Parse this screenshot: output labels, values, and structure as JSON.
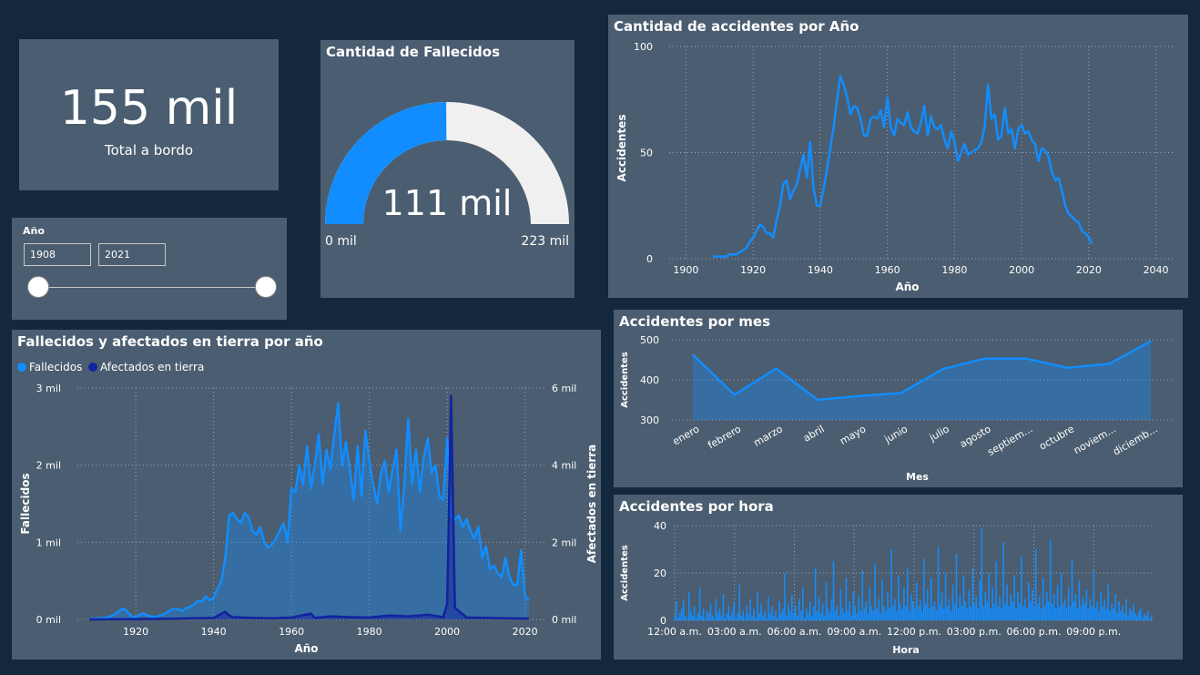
{
  "kpi": {
    "value": "155 mil",
    "label": "Total a bordo"
  },
  "slicer": {
    "title": "Año",
    "from": "1908",
    "to": "2021"
  },
  "gauge": {
    "title": "Cantidad de Fallecidos",
    "value_label": "111 mil",
    "min_label": "0 mil",
    "max_label": "223 mil",
    "value": 111,
    "min": 0,
    "max": 223
  },
  "colors": {
    "background": "#14283d",
    "card": "#4b5d70",
    "accent_blue": "#118dff",
    "dark_navy": "#12239e",
    "gauge_empty": "#f1f0f0"
  },
  "chart_data": [
    {
      "id": "accidentes_por_anio",
      "type": "line",
      "title": "Cantidad de accidentes por Año",
      "xlabel": "Año",
      "ylabel": "Accidentes",
      "xlim": [
        1895,
        2045
      ],
      "ylim": [
        0,
        100
      ],
      "xticks": [
        1900,
        1920,
        1940,
        1960,
        1980,
        2000,
        2020,
        2040
      ],
      "yticks": [
        0,
        50,
        100
      ],
      "grid": true,
      "x": [
        1908,
        1910,
        1912,
        1913,
        1914,
        1915,
        1916,
        1917,
        1918,
        1919,
        1920,
        1921,
        1922,
        1923,
        1924,
        1925,
        1926,
        1927,
        1928,
        1929,
        1930,
        1931,
        1932,
        1933,
        1934,
        1935,
        1936,
        1937,
        1938,
        1939,
        1940,
        1941,
        1942,
        1943,
        1944,
        1945,
        1946,
        1947,
        1948,
        1949,
        1950,
        1951,
        1952,
        1953,
        1954,
        1955,
        1956,
        1957,
        1958,
        1959,
        1960,
        1961,
        1962,
        1963,
        1964,
        1965,
        1966,
        1967,
        1968,
        1969,
        1970,
        1971,
        1972,
        1973,
        1974,
        1975,
        1976,
        1977,
        1978,
        1979,
        1980,
        1981,
        1982,
        1983,
        1984,
        1985,
        1986,
        1987,
        1988,
        1989,
        1990,
        1991,
        1992,
        1993,
        1994,
        1995,
        1996,
        1997,
        1998,
        1999,
        2000,
        2001,
        2002,
        2003,
        2004,
        2005,
        2006,
        2007,
        2008,
        2009,
        2010,
        2011,
        2012,
        2013,
        2014,
        2015,
        2016,
        2017,
        2018,
        2019,
        2020,
        2021
      ],
      "y": [
        1,
        1,
        1,
        2,
        2,
        2,
        3,
        4,
        5,
        8,
        10,
        13,
        16,
        15,
        12,
        12,
        10,
        18,
        25,
        35,
        37,
        28,
        32,
        35,
        42,
        49,
        38,
        55,
        33,
        25,
        25,
        33,
        42,
        52,
        62,
        75,
        86,
        82,
        76,
        68,
        72,
        71,
        66,
        58,
        58,
        66,
        67,
        66,
        70,
        62,
        76,
        62,
        58,
        66,
        64,
        63,
        69,
        62,
        60,
        59,
        64,
        72,
        58,
        67,
        62,
        61,
        63,
        56,
        52,
        60,
        55,
        46,
        50,
        54,
        49,
        50,
        51,
        52,
        55,
        62,
        82,
        66,
        68,
        56,
        58,
        71,
        59,
        61,
        52,
        61,
        63,
        59,
        60,
        56,
        54,
        46,
        52,
        51,
        48,
        41,
        37,
        38,
        32,
        25,
        21,
        20,
        18,
        17,
        13,
        12,
        10,
        7
      ]
    },
    {
      "id": "fallecidos_afectados",
      "type": "area",
      "title": "Fallecidos y afectados en tierra por año",
      "xlabel": "Año",
      "ylabel": "Fallecidos",
      "ylabel_right": "Afectados en tierra",
      "xlim": [
        1905,
        2025
      ],
      "ylim": [
        0,
        3000
      ],
      "ylim_right": [
        0,
        6000
      ],
      "xticks": [
        1920,
        1940,
        1960,
        1980,
        2000,
        2020
      ],
      "yticks": [
        0,
        1000,
        2000,
        3000
      ],
      "ytick_labels": [
        "0 mil",
        "1 mil",
        "2 mil",
        "3 mil"
      ],
      "yticks_right": [
        0,
        2000,
        4000,
        6000
      ],
      "ytick_labels_right": [
        "0 mil",
        "2 mil",
        "4 mil",
        "6 mil"
      ],
      "legend": "top-left",
      "grid": true,
      "series": [
        {
          "name": "Fallecidos",
          "axis": "left",
          "x": [
            1908,
            1912,
            1913,
            1914,
            1915,
            1916,
            1917,
            1918,
            1919,
            1920,
            1921,
            1922,
            1923,
            1924,
            1925,
            1926,
            1927,
            1928,
            1929,
            1930,
            1931,
            1932,
            1933,
            1934,
            1935,
            1936,
            1937,
            1938,
            1939,
            1940,
            1941,
            1942,
            1943,
            1944,
            1945,
            1946,
            1947,
            1948,
            1949,
            1950,
            1951,
            1952,
            1953,
            1954,
            1955,
            1956,
            1957,
            1958,
            1959,
            1960,
            1961,
            1962,
            1963,
            1964,
            1965,
            1966,
            1967,
            1968,
            1969,
            1970,
            1971,
            1972,
            1973,
            1974,
            1975,
            1976,
            1977,
            1978,
            1979,
            1980,
            1981,
            1982,
            1983,
            1984,
            1985,
            1986,
            1987,
            1988,
            1989,
            1990,
            1991,
            1992,
            1993,
            1994,
            1995,
            1996,
            1997,
            1998,
            1999,
            2000,
            2001,
            2002,
            2003,
            2004,
            2005,
            2006,
            2007,
            2008,
            2009,
            2010,
            2011,
            2012,
            2013,
            2014,
            2015,
            2016,
            2017,
            2018,
            2019,
            2020,
            2021
          ],
          "y": [
            5,
            20,
            30,
            50,
            80,
            120,
            140,
            90,
            40,
            30,
            60,
            80,
            50,
            40,
            30,
            50,
            60,
            90,
            120,
            140,
            130,
            110,
            150,
            160,
            200,
            240,
            230,
            300,
            250,
            280,
            400,
            500,
            800,
            1350,
            1380,
            1300,
            1250,
            1380,
            1320,
            1150,
            1100,
            1200,
            1000,
            930,
            970,
            1050,
            1150,
            1250,
            1000,
            1700,
            1650,
            2000,
            1750,
            2250,
            1700,
            2000,
            2400,
            1750,
            2200,
            1950,
            2400,
            2800,
            2000,
            2300,
            1950,
            1550,
            2250,
            1600,
            2450,
            2050,
            1750,
            1500,
            1900,
            2050,
            1650,
            1950,
            2200,
            1150,
            1750,
            2600,
            1750,
            2200,
            1650,
            2100,
            2350,
            1900,
            2000,
            1600,
            1550,
            2350,
            1350,
            1300,
            1350,
            1200,
            1300,
            1150,
            1050,
            1200,
            800,
            950,
            650,
            700,
            600,
            550,
            800,
            550,
            450,
            450,
            900,
            300,
            250
          ]
        },
        {
          "name": "Afectados en tierra",
          "axis": "right",
          "x": [
            1908,
            1920,
            1930,
            1940,
            1943,
            1944,
            1945,
            1950,
            1955,
            1960,
            1965,
            1966,
            1970,
            1975,
            1980,
            1985,
            1990,
            1995,
            1999,
            2000,
            2001,
            2002,
            2005,
            2010,
            2015,
            2021
          ],
          "y": [
            0,
            10,
            20,
            40,
            200,
            100,
            60,
            40,
            30,
            50,
            150,
            40,
            80,
            60,
            50,
            100,
            80,
            120,
            60,
            400,
            5800,
            300,
            50,
            40,
            30,
            20
          ]
        }
      ]
    },
    {
      "id": "accidentes_por_mes",
      "type": "area",
      "title": "Accidentes por mes",
      "xlabel": "Mes",
      "ylabel": "Accidentes",
      "ylim": [
        300,
        500
      ],
      "yticks": [
        300,
        400,
        500
      ],
      "grid": true,
      "categories": [
        "enero",
        "febrero",
        "marzo",
        "abril",
        "mayo",
        "junio",
        "julio",
        "agosto",
        "septiem...",
        "octubre",
        "noviem...",
        "diciemb..."
      ],
      "values": [
        463,
        363,
        428,
        350,
        360,
        367,
        427,
        453,
        453,
        430,
        440,
        497
      ]
    },
    {
      "id": "accidentes_por_hora",
      "type": "bar",
      "title": "Accidentes por hora",
      "xlabel": "Hora",
      "ylabel": "Accidentes",
      "ylim": [
        0,
        40
      ],
      "yticks": [
        0,
        20,
        40
      ],
      "xtick_labels": [
        "12:00 a.m.",
        "03:00 a.m.",
        "06:00 a.m.",
        "09:00 a.m.",
        "12:00 p.m.",
        "03:00 p.m.",
        "06:00 p.m.",
        "09:00 p.m."
      ],
      "grid": true,
      "values": [
        2,
        8,
        1,
        3,
        5,
        9,
        2,
        1,
        12,
        4,
        2,
        6,
        1,
        3,
        14,
        2,
        5,
        1,
        4,
        3,
        7,
        2,
        1,
        9,
        3,
        5,
        2,
        11,
        1,
        3,
        6,
        2,
        4,
        8,
        1,
        3,
        15,
        2,
        4,
        1,
        6,
        3,
        9,
        2,
        5,
        1,
        12,
        3,
        7,
        2,
        4,
        1,
        10,
        3,
        6,
        2,
        4,
        1,
        8,
        3,
        5,
        20,
        2,
        7,
        4,
        11,
        3,
        6,
        2,
        9,
        4,
        14,
        1,
        5,
        3,
        8,
        2,
        6,
        22,
        4,
        10,
        3,
        7,
        2,
        16,
        5,
        3,
        9,
        25,
        4,
        6,
        2,
        13,
        5,
        3,
        18,
        4,
        8,
        2,
        12,
        6,
        3,
        10,
        4,
        21,
        5,
        8,
        3,
        14,
        6,
        4,
        24,
        5,
        9,
        3,
        17,
        6,
        4,
        12,
        5,
        30,
        6,
        9,
        4,
        19,
        7,
        5,
        14,
        6,
        22,
        4,
        11,
        8,
        5,
        16,
        6,
        9,
        4,
        26,
        7,
        13,
        5,
        18,
        6,
        8,
        4,
        31,
        7,
        12,
        5,
        20,
        6,
        9,
        4,
        15,
        7,
        28,
        5,
        11,
        6,
        19,
        8,
        5,
        13,
        6,
        22,
        7,
        10,
        5,
        17,
        39,
        6,
        12,
        8,
        20,
        5,
        14,
        7,
        25,
        6,
        10,
        5,
        33,
        7,
        15,
        6,
        11,
        8,
        19,
        5,
        12,
        7,
        27,
        6,
        9,
        5,
        16,
        8,
        13,
        6,
        30,
        7,
        10,
        5,
        18,
        6,
        12,
        8,
        34,
        7,
        11,
        5,
        15,
        6,
        20,
        7,
        9,
        5,
        14,
        6,
        26,
        8,
        11,
        5,
        17,
        6,
        10,
        7,
        13,
        5,
        9,
        6,
        21,
        5,
        8,
        4,
        12,
        6,
        9,
        5,
        15,
        4,
        7,
        5,
        11,
        3,
        8,
        4,
        6,
        3,
        9,
        2,
        5,
        4,
        7,
        3,
        2,
        4,
        5,
        1,
        3,
        2,
        4,
        1,
        2
      ]
    }
  ]
}
